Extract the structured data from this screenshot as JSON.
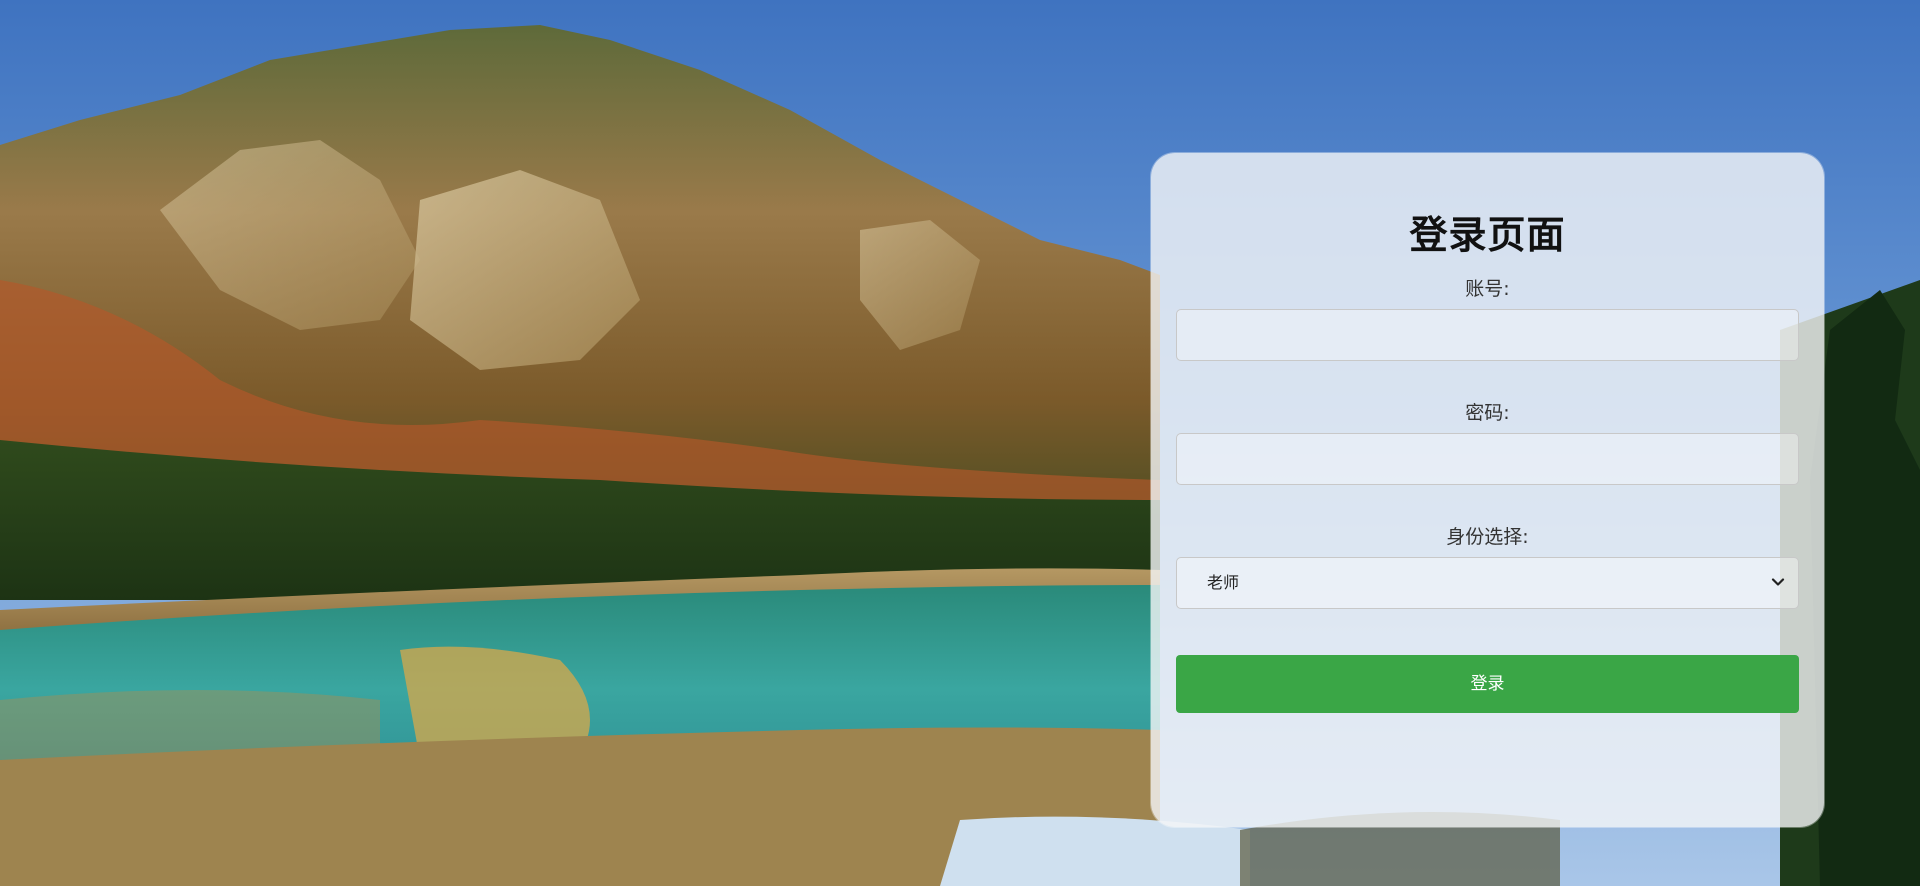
{
  "login": {
    "title": "登录页面",
    "account_label": "账号:",
    "account_value": "",
    "password_label": "密码:",
    "password_value": "",
    "role_label": "身份选择:",
    "role_selected": "老师",
    "submit_label": "登录"
  },
  "colors": {
    "button_green": "#3aa646",
    "card_background": "#f5f6f8",
    "sky": "#4b7fc6"
  },
  "icons": {
    "select_arrow": "chevron-down-icon"
  }
}
